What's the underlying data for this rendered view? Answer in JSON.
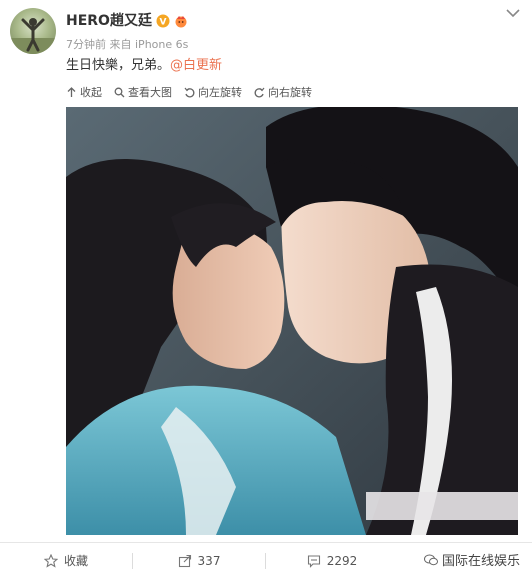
{
  "post": {
    "username": "HERO趙又廷",
    "verified_icon": "verified-badge-icon",
    "member_icon": "member-crown-icon",
    "time": "7分钟前",
    "source_prefix": "来自",
    "source": "iPhone 6s",
    "text": "生日快樂，兄弟。",
    "mention": "@白更新"
  },
  "image_toolbar": {
    "collapse": "收起",
    "view_large": "查看大图",
    "rotate_left": "向左旋转",
    "rotate_right": "向右旋转"
  },
  "actions": {
    "favorite": "收藏",
    "share_count": "337",
    "comment_count": "2292"
  },
  "watermark": {
    "text": "国际在线娱乐"
  },
  "colors": {
    "accent": "#eb7350",
    "verified": "#f5a623"
  }
}
